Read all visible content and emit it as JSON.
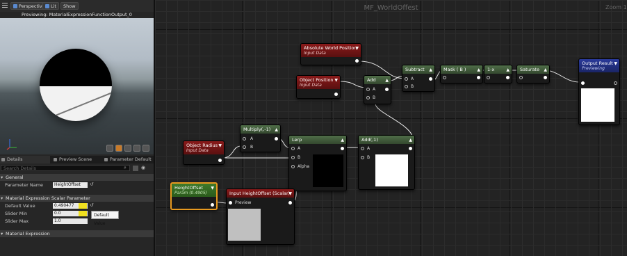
{
  "toolbar": {
    "perspective": "Perspective",
    "lit": "Lit",
    "show": "Show"
  },
  "viewport": {
    "previewing": "Previewing: MaterialExpressionFunctionOutput_0"
  },
  "details": {
    "tabs": [
      {
        "label": "Details"
      },
      {
        "label": "Preview Scene Sett"
      },
      {
        "label": "Parameter Default"
      }
    ],
    "search_placeholder": "Search Details",
    "section_general": "General",
    "param_name_label": "Parameter Name",
    "param_name_value": "HeightOffset",
    "section_scalar": "Material Expression Scalar Parameter",
    "default_value_label": "Default Value",
    "default_value": "0.490477",
    "slider_min_label": "Slider Min",
    "slider_min": "0.0",
    "slider_max_label": "Slider Max",
    "slider_max": "1.0",
    "tooltip": "Default Value",
    "section_expression": "Material Expression"
  },
  "graph": {
    "title": "MF_WorldOffest",
    "zoom": "Zoom 1",
    "nodes": {
      "abs_world_pos": {
        "title": "Absolute World Position",
        "sub": "Input Data"
      },
      "object_position": {
        "title": "Object Position",
        "sub": "Input Data"
      },
      "add": {
        "title": "Add",
        "a": "A",
        "b": "B"
      },
      "subtract": {
        "title": "Subtract",
        "a": "A",
        "b": "B"
      },
      "mask": {
        "title": "Mask ( B )"
      },
      "one_minus": {
        "title": "1-x"
      },
      "saturate": {
        "title": "Saturate"
      },
      "output": {
        "title": "Output Result",
        "sub": "Previewing"
      },
      "object_radius": {
        "title": "Object Radius",
        "sub": "Input Data"
      },
      "multiply": {
        "title": "Multiply(,-1)",
        "a": "A",
        "b": "B"
      },
      "lerp": {
        "title": "Lerp",
        "a": "A",
        "b": "B",
        "alpha": "Alpha"
      },
      "add1": {
        "title": "Add(,1)",
        "a": "A",
        "b": "B"
      },
      "height_offset": {
        "title": "HeightOffset",
        "sub": "Param (0.4905)"
      },
      "input_height": {
        "title": "Input HeightOffset (Scalar)",
        "preview": "Preview"
      }
    }
  }
}
